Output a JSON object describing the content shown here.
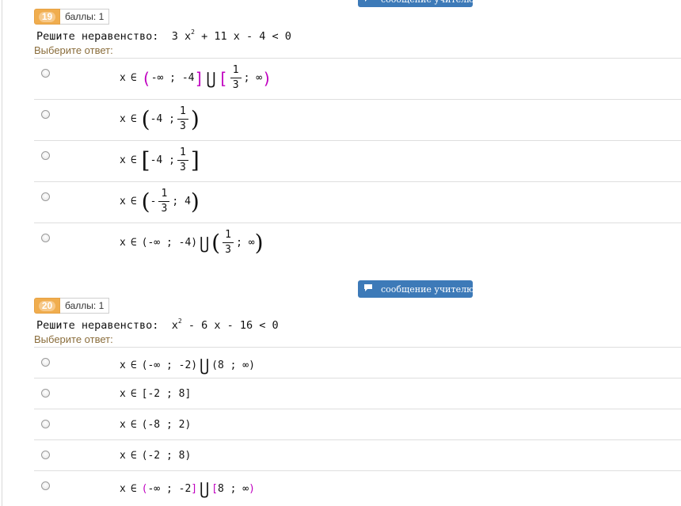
{
  "message_button_label": "сообщение учителю",
  "choose_label": "Выберите ответ:",
  "questions": [
    {
      "number": "19",
      "score": "баллы: 1",
      "prompt": "Решите неравенство:",
      "inequality": {
        "a": "3 x",
        "exp": "2",
        "rest": "+ 11 x - 4 < 0"
      },
      "options": [
        {
          "pre": "x",
          "elem": "∈",
          "l1": "(",
          "p1": "-∞ ; -4",
          "r1": "]",
          "union": "⋃",
          "l2": "[",
          "num": "1",
          "den": "3",
          "p2": "; ∞",
          "r2": ")"
        },
        {
          "pre": "x",
          "elem": "∈",
          "l1": "(",
          "p1": "-4 ;",
          "num": "1",
          "den": "3",
          "r1": ")"
        },
        {
          "pre": "x",
          "elem": "∈",
          "l1": "[",
          "p1": "-4 ;",
          "num": "1",
          "den": "3",
          "r1": "]"
        },
        {
          "pre": "x",
          "elem": "∈",
          "l1": "(",
          "sign": "-",
          "num": "1",
          "den": "3",
          "p1": "; 4",
          "r1": ")"
        },
        {
          "pre": "x",
          "elem": "∈",
          "l1": "(",
          "p1": "-∞ ; -4",
          "r1": ")",
          "union": "⋃",
          "l2": "(",
          "num": "1",
          "den": "3",
          "p2": "; ∞",
          "r2": ")"
        }
      ]
    },
    {
      "number": "20",
      "score": "баллы: 1",
      "prompt": "Решите неравенство:",
      "inequality": {
        "a": "x",
        "exp": "2",
        "rest": "- 6 x - 16 < 0"
      },
      "options": [
        {
          "pre": "x",
          "elem": "∈",
          "p1": "(-∞ ; -2)",
          "union": "⋃",
          "p2": "(8 ; ∞)"
        },
        {
          "pre": "x",
          "elem": "∈",
          "p1": "[-2 ; 8]"
        },
        {
          "pre": "x",
          "elem": "∈",
          "p1": "(-8 ; 2)"
        },
        {
          "pre": "x",
          "elem": "∈",
          "p1": "(-2 ; 8)"
        },
        {
          "pre": "x",
          "elem": "∈",
          "l1": "(",
          "p1": "-∞ ; -2",
          "r1": "]",
          "union": "⋃",
          "l2": "[",
          "p2": "8 ; ∞",
          "r2": ")"
        }
      ]
    }
  ]
}
